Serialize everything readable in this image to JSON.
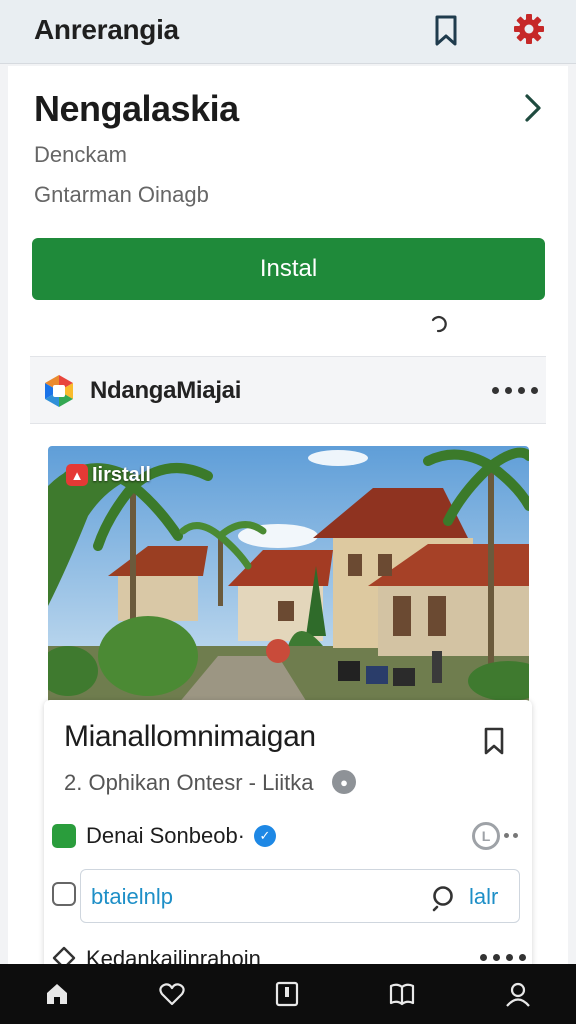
{
  "header": {
    "title": "Anrerangia"
  },
  "app": {
    "name": "Nengalaskia",
    "developer": "Denckam",
    "subtitle": "Gntarman Oinagb",
    "install_label": "Instal"
  },
  "source": {
    "name": "NdangaMiajai"
  },
  "feature": {
    "badge": "Iirstall",
    "title": "Mianallomnimaigan",
    "meta": "2. Ophikan Ontesr - Liitka"
  },
  "author": {
    "name": "Denai Sonbeob·"
  },
  "search": {
    "value": "btaielnlp",
    "label": "lalr"
  },
  "next_item": {
    "name": "Kedankailinrahoin"
  },
  "colors": {
    "accent_green": "#1f8a3a",
    "link_blue": "#1e8fc7",
    "verified_blue": "#1e88e5",
    "settings_red": "#c62828"
  },
  "icons": [
    "bookmark-icon",
    "gear-icon",
    "chevron-right-icon",
    "loading-icon",
    "app-logo-icon",
    "more-icon",
    "verified-icon",
    "timer-icon",
    "chat-icon",
    "search-icon",
    "home-icon",
    "heart-icon",
    "library-icon",
    "book-icon",
    "profile-icon"
  ]
}
